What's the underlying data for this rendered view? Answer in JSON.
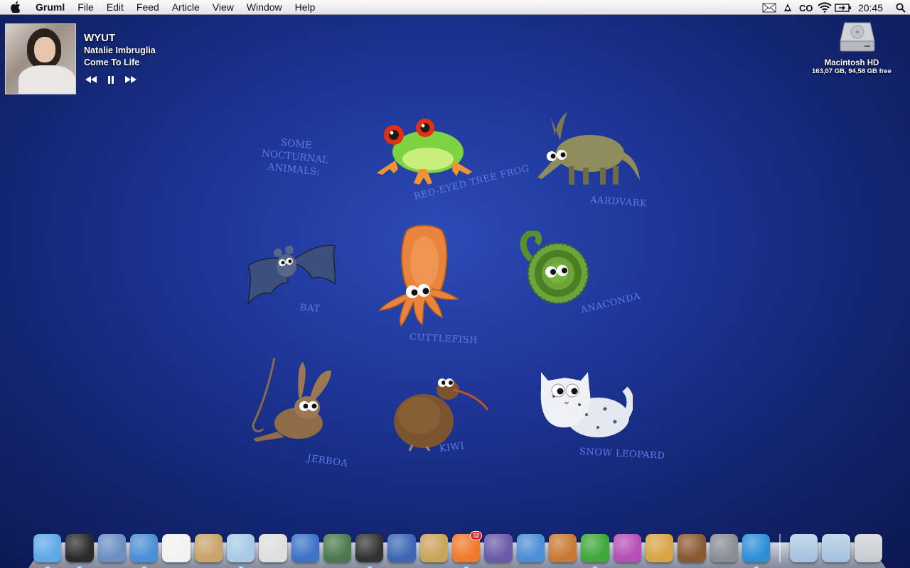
{
  "menubar": {
    "app_name": "Gruml",
    "menus": [
      "File",
      "Edit",
      "Feed",
      "Article",
      "View",
      "Window",
      "Help"
    ],
    "status_icons": [
      "mail-icon",
      "stamp-icon",
      "co-icon",
      "wifi-icon",
      "battery-icon"
    ],
    "clock": "20:45"
  },
  "now_playing": {
    "title": "WYUT",
    "artist": "Natalie Imbruglia",
    "album": "Come To Life",
    "controls": [
      "previous-icon",
      "pause-icon",
      "next-icon"
    ]
  },
  "desktop": {
    "drive": {
      "name": "Macintosh HD",
      "info": "163,07 GB, 94,58 GB free"
    },
    "wallpaper": {
      "headline": [
        "Some",
        "Nocturnal",
        "Animals:"
      ],
      "captions": {
        "frog": "Red-eyed tree frog",
        "aardvark": "Aardvark",
        "bat": "Bat",
        "cuttlefish": "Cuttlefish",
        "anaconda": "Anaconda",
        "jerboa": "Jerboa",
        "kiwi": "Kiwi",
        "leopard": "Snow Leopard"
      }
    }
  },
  "dock": {
    "apps": [
      {
        "name": "finder",
        "color": "#5fa8e8"
      },
      {
        "name": "dashboard",
        "color": "#2a2a2a"
      },
      {
        "name": "mail",
        "color": "#6a8fc4"
      },
      {
        "name": "safari",
        "color": "#4b8fd6"
      },
      {
        "name": "ical",
        "color": "#f2f2f2"
      },
      {
        "name": "iphoto",
        "color": "#c9a46a"
      },
      {
        "name": "itunes",
        "color": "#a7c9e6"
      },
      {
        "name": "times",
        "color": "#dedede"
      },
      {
        "name": "things",
        "color": "#3c73c8"
      },
      {
        "name": "screenshot",
        "color": "#4c7a4c"
      },
      {
        "name": "dvd-player",
        "color": "#333333"
      },
      {
        "name": "textmate",
        "color": "#3d67b5"
      },
      {
        "name": "notes",
        "color": "#caa45a"
      },
      {
        "name": "rss-reader",
        "color": "#f07a2a",
        "badge": "52"
      },
      {
        "name": "script-editor",
        "color": "#6b5aa8"
      },
      {
        "name": "numbers",
        "color": "#4d8ed6"
      },
      {
        "name": "keynote",
        "color": "#c97a32"
      },
      {
        "name": "adium",
        "color": "#3ea83a"
      },
      {
        "name": "font-app",
        "color": "#b64fb6"
      },
      {
        "name": "image-capture",
        "color": "#d8a545"
      },
      {
        "name": "garageband",
        "color": "#8a5a32"
      },
      {
        "name": "system-preferences",
        "color": "#8a8f96"
      },
      {
        "name": "messages",
        "color": "#2d8fd8"
      }
    ],
    "folders": [
      {
        "name": "documents-folder",
        "color": "#9fc1de"
      },
      {
        "name": "downloads-folder",
        "color": "#9fc1de"
      },
      {
        "name": "trash",
        "color": "#c5c9cf"
      }
    ]
  }
}
